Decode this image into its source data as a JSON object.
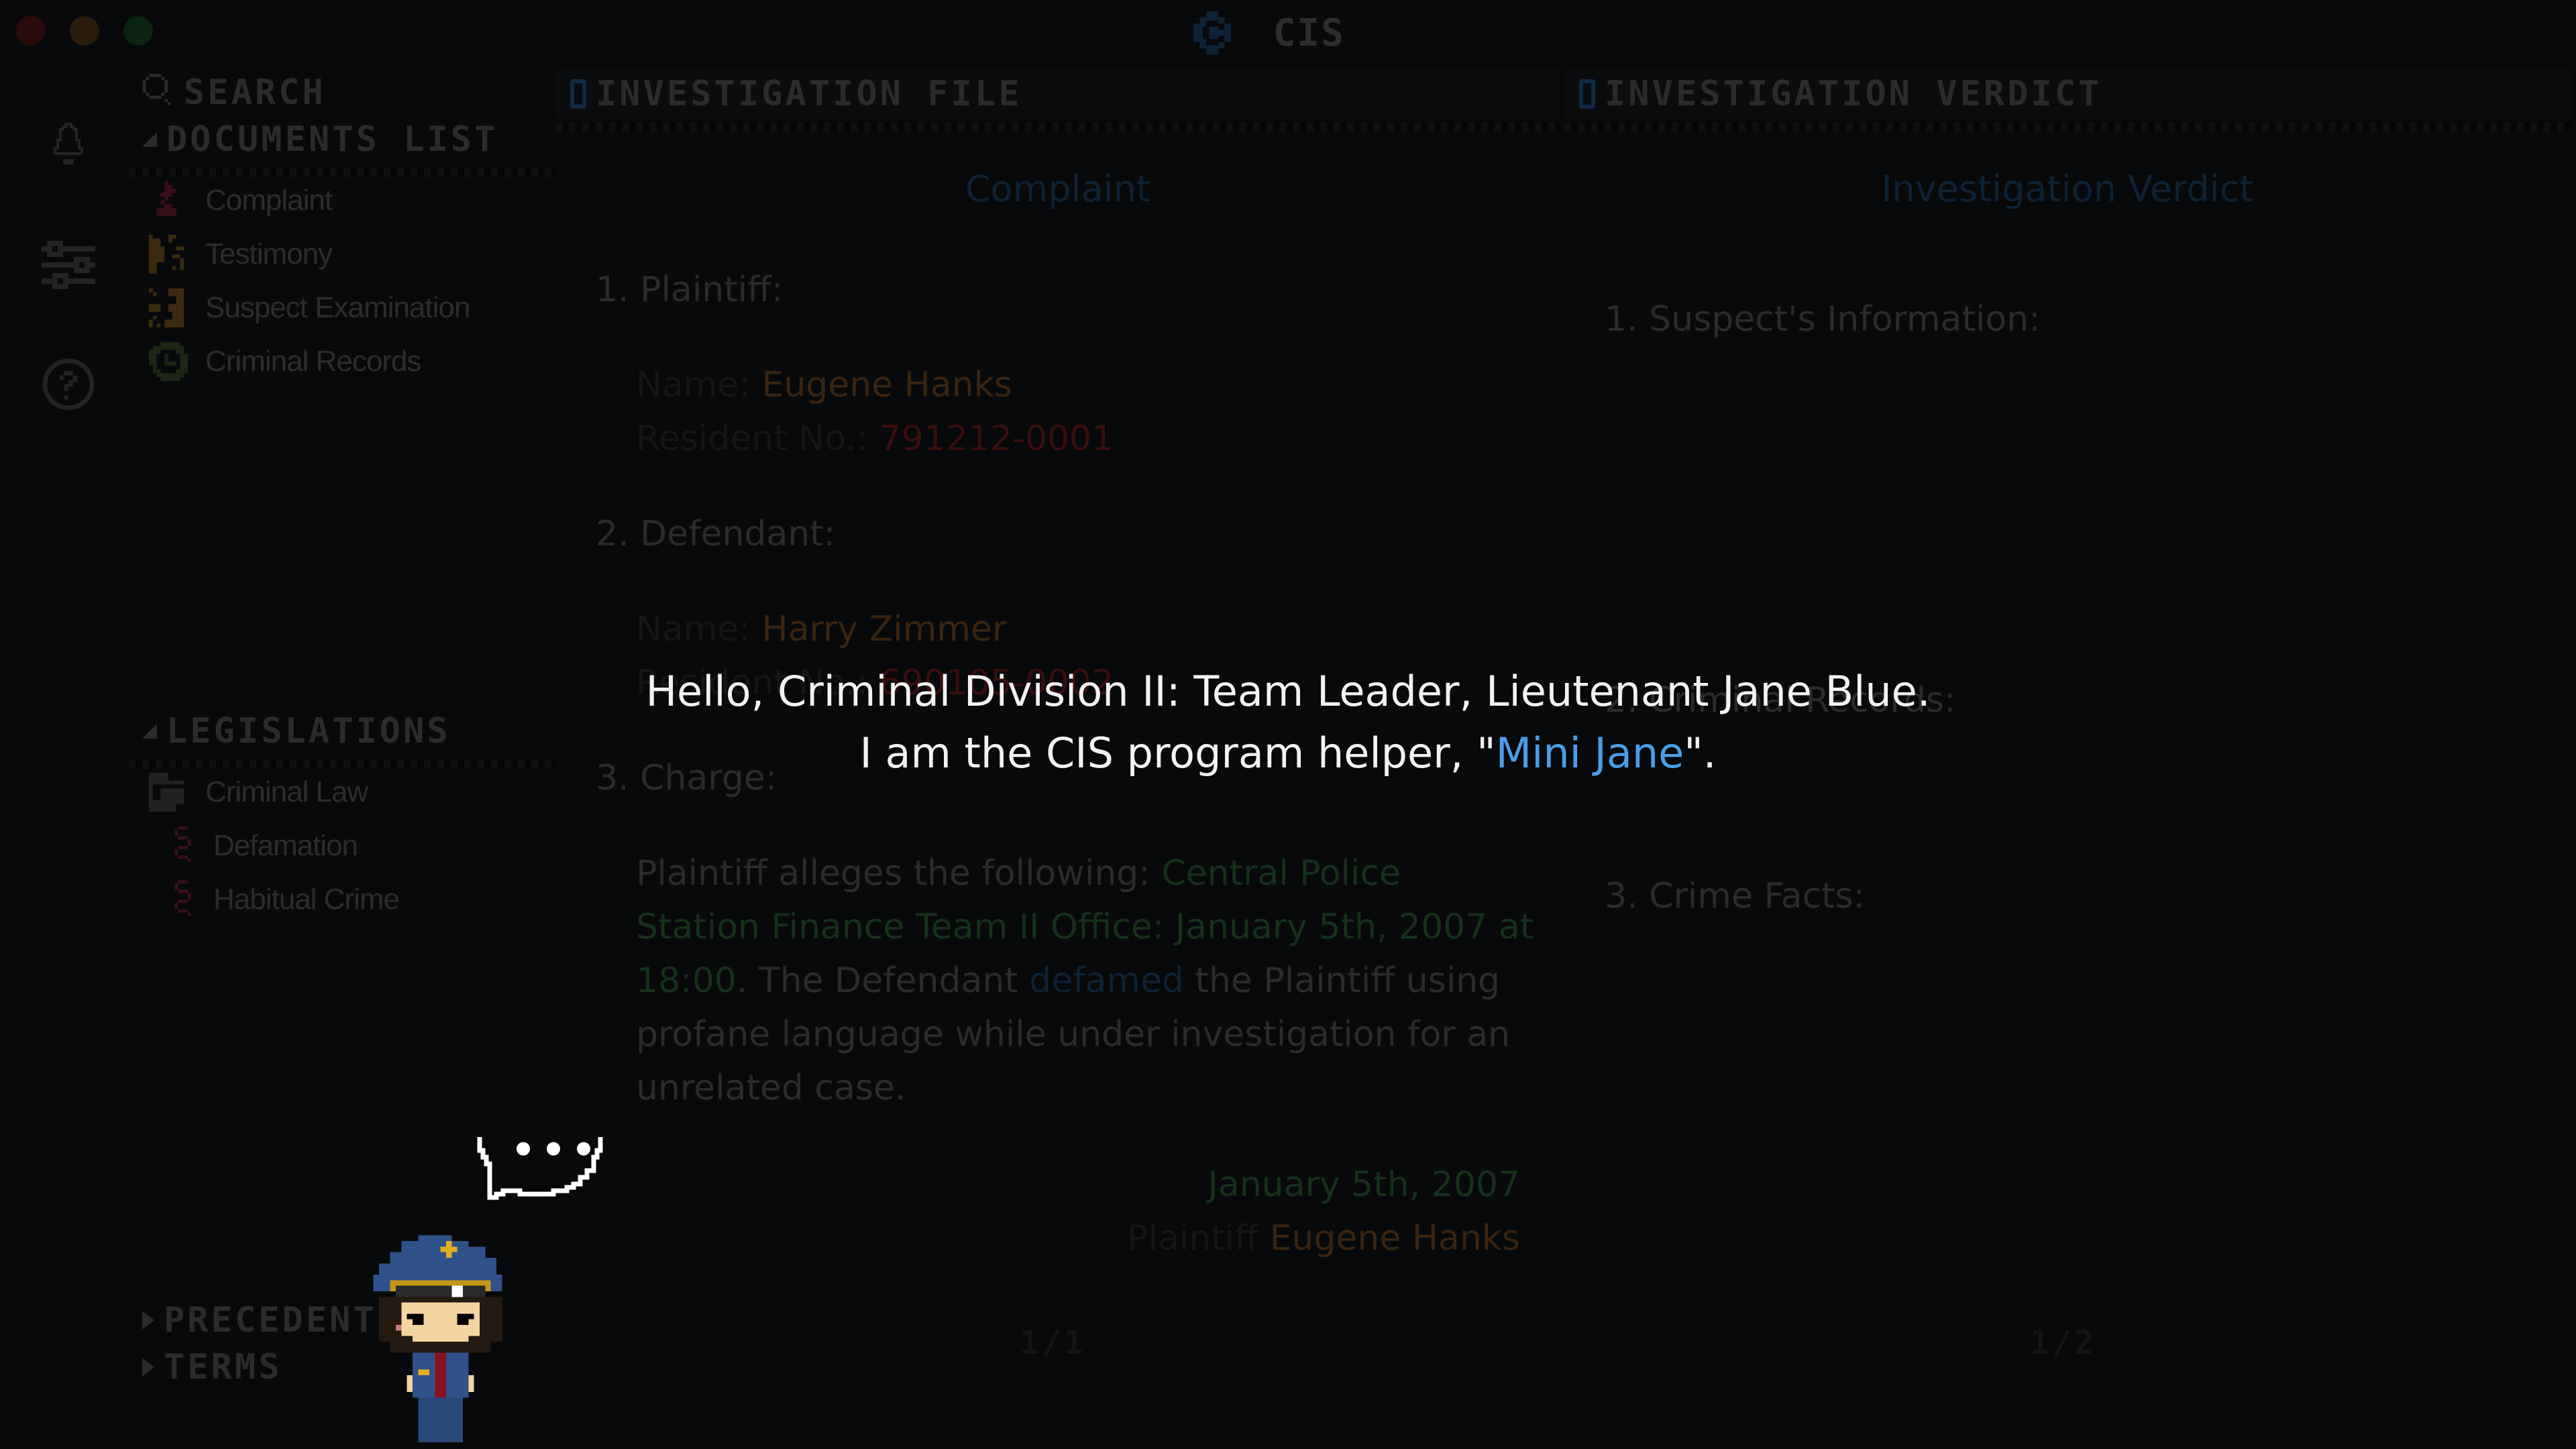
{
  "window": {
    "title_prefix": "K",
    "title": "CIS",
    "traffic_lights": {
      "close": "#2a0b0b",
      "minimize": "#2a1c0a",
      "maximize": "#0b2410"
    }
  },
  "rail": {
    "icons": [
      "bell-icon",
      "sliders-icon",
      "help-icon"
    ]
  },
  "sidebar": {
    "search_label": "Search",
    "documents_header": "Documents List",
    "documents": [
      {
        "label": "Complaint",
        "icon": "complaint-icon",
        "color": "#3a1018"
      },
      {
        "label": "Testimony",
        "icon": "testimony-icon",
        "color": "#3a2a10"
      },
      {
        "label": "Suspect Examination",
        "icon": "examination-icon",
        "color": "#3a2a10"
      },
      {
        "label": "Criminal Records",
        "icon": "records-icon",
        "color": "#1c2614"
      }
    ],
    "legislations_header": "Legislations",
    "legislations": {
      "folder": "Criminal Law",
      "items": [
        "Defamation",
        "Habitual Crime"
      ]
    },
    "precedents_header": "Precedents",
    "terms_header": "Terms"
  },
  "investigation_file": {
    "tab_label": "Investigation File",
    "doc_title": "Complaint",
    "plaintiff_heading": "1. Plaintiff:",
    "plaintiff_name_label": "Name:",
    "plaintiff_name": "Eugene Hanks",
    "plaintiff_id_label": "Resident No.:",
    "plaintiff_id": "791212-0001",
    "defendant_heading": "2. Defendant:",
    "defendant_name_label": "Name:",
    "defendant_name": "Harry Zimmer",
    "defendant_id_label": "Resident No.:",
    "defendant_id": "690105-0002",
    "charge_heading": "3. Charge:",
    "charge_intro": "Plaintiff alleges the following: ",
    "charge_place_time": "Central Police Station Finance Team II Office: January 5th, 2007 at 18:00",
    "charge_mid": ". The Defendant ",
    "charge_keyword": "defamed",
    "charge_end": " the Plaintiff using profane language while under investigation for an unrelated case.",
    "signature_date": "January 5th, 2007",
    "signature_label": "Plaintiff",
    "signature_name": "Eugene Hanks",
    "page": "1/1"
  },
  "investigation_verdict": {
    "tab_label": "Investigation Verdict",
    "doc_title": "Investigation Verdict",
    "section1": "1. Suspect's Information:",
    "section2": "2. Criminal Records:",
    "section3": "3. Crime Facts:",
    "page": "1/2"
  },
  "dialog": {
    "line1": "Hello, Criminal Division II: Team Leader, Lieutenant Jane Blue.",
    "line2_pre": "I am the CIS program helper, \"",
    "line2_name": "Mini Jane",
    "line2_post": "\".",
    "accent": "#4a9ee6"
  },
  "helper": {
    "bubble_text": "•••",
    "character": "Mini Jane"
  }
}
